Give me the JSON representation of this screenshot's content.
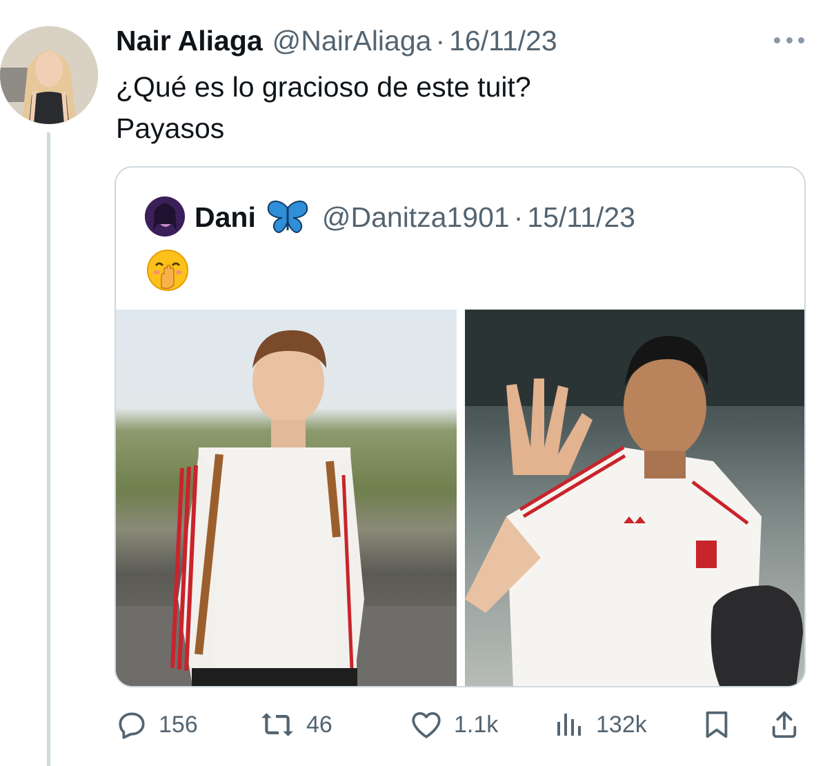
{
  "tweet": {
    "author_name": "Nair Aliaga",
    "author_handle": "@NairAliaga",
    "separator": "·",
    "date": "16/11/23",
    "text_line1": "¿Qué es lo gracioso de este tuit?",
    "text_line2": "Payasos"
  },
  "quoted": {
    "author_name": "Dani",
    "author_handle": "@Danitza1901",
    "separator": "·",
    "date": "15/11/23",
    "emoji": "hand-over-mouth-emoji",
    "images": [
      {
        "description_icon": "photo-player-backpack"
      },
      {
        "description_icon": "photo-player-waving"
      }
    ]
  },
  "actions": {
    "replies": "156",
    "retweets": "46",
    "likes": "1.1k",
    "views": "132k"
  },
  "colors": {
    "text_primary": "#0f1419",
    "text_secondary": "#536471",
    "border": "#cfd9de",
    "thread_line": "#cfd9de"
  }
}
